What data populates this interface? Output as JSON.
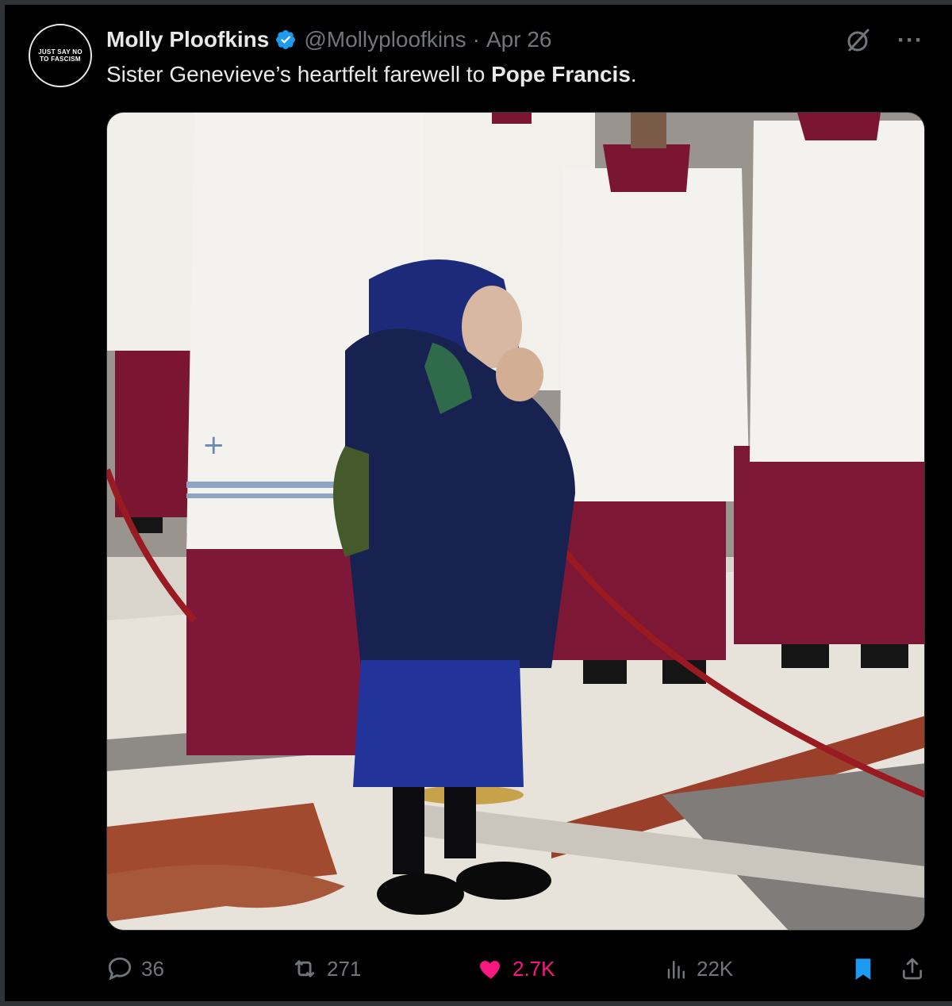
{
  "avatar": {
    "line1": "JUST SAY NO",
    "line2": "TO FASCISM"
  },
  "author": {
    "display_name": "Molly Ploofkins",
    "handle": "@Mollyploofkins",
    "separator": "·",
    "date": "Apr 26"
  },
  "tweet": {
    "text_before": "Sister Genevieve’s heartfelt farewell to ",
    "text_bold": "Pope Francis",
    "text_after": "."
  },
  "top_actions": {
    "grok_icon": "grok-icon",
    "more_label": "···"
  },
  "engagement": {
    "replies": "36",
    "reposts": "271",
    "likes": "2.7K",
    "views": "22K"
  },
  "colors": {
    "background": "#000000",
    "text": "#e7e9ea",
    "muted": "#71767b",
    "verified": "#1d9bf0",
    "like": "#f91880",
    "bookmark": "#1d9bf0",
    "border": "#2f3336"
  }
}
